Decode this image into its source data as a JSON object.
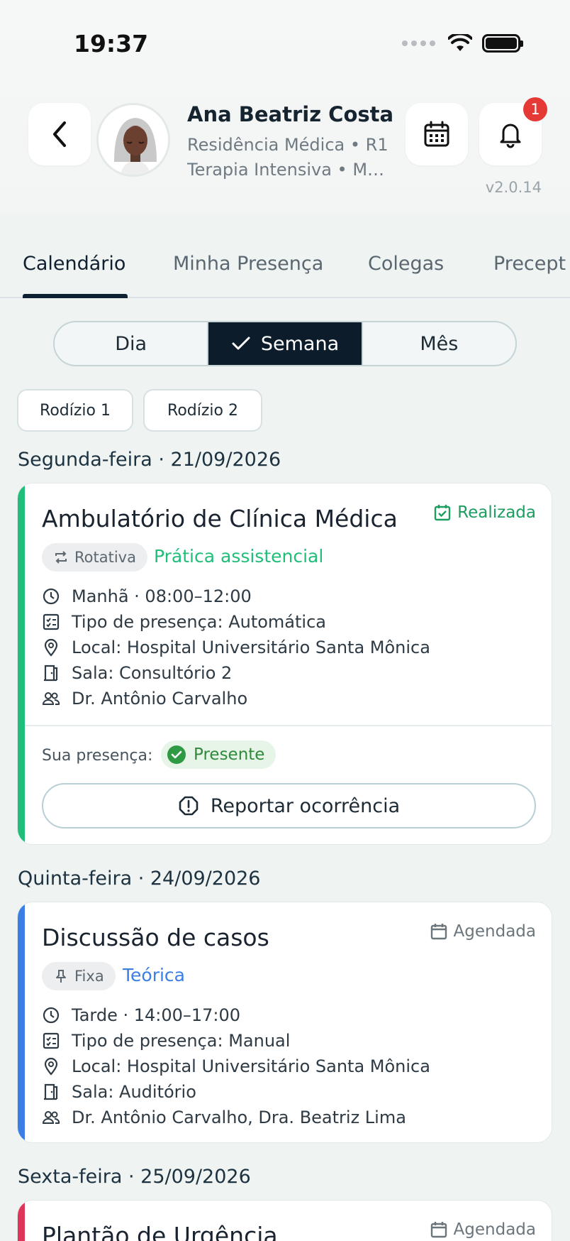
{
  "status_bar": {
    "time": "19:37"
  },
  "header": {
    "user_name": "Ana Beatriz Costa",
    "line1": "Residência Médica • R1",
    "line2": "Terapia Intensiva • Me...",
    "notification_count": "1",
    "version": "v2.0.14"
  },
  "tabs": [
    {
      "label": "Calendário",
      "active": true
    },
    {
      "label": "Minha Presença",
      "active": false
    },
    {
      "label": "Colegas",
      "active": false
    },
    {
      "label": "Precept",
      "active": false
    }
  ],
  "view_toggle": {
    "options": [
      "Dia",
      "Semana",
      "Mês"
    ],
    "selected": "Semana"
  },
  "rotations": [
    "Rodízio 1",
    "Rodízio 2"
  ],
  "days": [
    {
      "header": "Segunda-feira · 21/09/2026",
      "card": {
        "title": "Ambulatório de Clínica Médica",
        "status": "Realizada",
        "tag": "Rotativa",
        "type": "Prática assistencial",
        "accent": "#1fbf7a",
        "rows": [
          "Manhã · 08:00–12:00",
          "Tipo de presença: Automática",
          "Local: Hospital Universitário Santa Mônica",
          "Sala: Consultório 2",
          "Dr. Antônio Carvalho"
        ],
        "presence_label": "Sua presença:",
        "presence_value": "Presente",
        "report_label": "Reportar ocorrência"
      }
    },
    {
      "header": "Quinta-feira · 24/09/2026",
      "card": {
        "title": "Discussão de casos",
        "status": "Agendada",
        "tag": "Fixa",
        "type": "Teórica",
        "accent": "#3a7ee6",
        "rows": [
          "Tarde · 14:00–17:00",
          "Tipo de presença: Manual",
          "Local: Hospital Universitário Santa Mônica",
          "Sala: Auditório",
          "Dr. Antônio Carvalho, Dra. Beatriz Lima"
        ]
      }
    },
    {
      "header": "Sexta-feira · 25/09/2026",
      "card": {
        "title": "Plantão de Urgência",
        "status": "Agendada",
        "accent": "#e0355a"
      }
    }
  ]
}
